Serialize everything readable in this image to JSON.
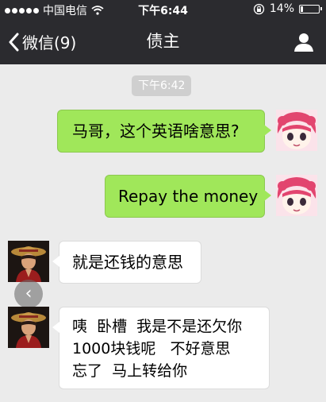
{
  "status_bar": {
    "carrier": "中国电信",
    "time": "下午6:44",
    "battery": "14%"
  },
  "nav": {
    "back_label": "微信(9)",
    "title": "债主"
  },
  "chat": {
    "timestamp": "下午6:42",
    "messages": [
      {
        "from": "me",
        "text": "马哥，这个英语啥意思?"
      },
      {
        "from": "me",
        "text": "Repay the money"
      },
      {
        "from": "other",
        "text": "就是还钱的意思"
      },
      {
        "from": "other",
        "lines": [
          "咦  卧槽  我是不是还欠你",
          "1000块钱呢   不好意思",
          "忘了  马上转给你"
        ]
      }
    ]
  },
  "colors": {
    "nav_bg": "#2b2b2f",
    "chat_bg": "#ebebeb",
    "out_bubble": "#a0e75a",
    "in_bubble": "#ffffff"
  },
  "icons": [
    "signal-dots-icon",
    "wifi-icon",
    "lock-rotation-icon",
    "battery-icon",
    "back-chevron-icon",
    "person-icon",
    "left-arrow-icon"
  ]
}
